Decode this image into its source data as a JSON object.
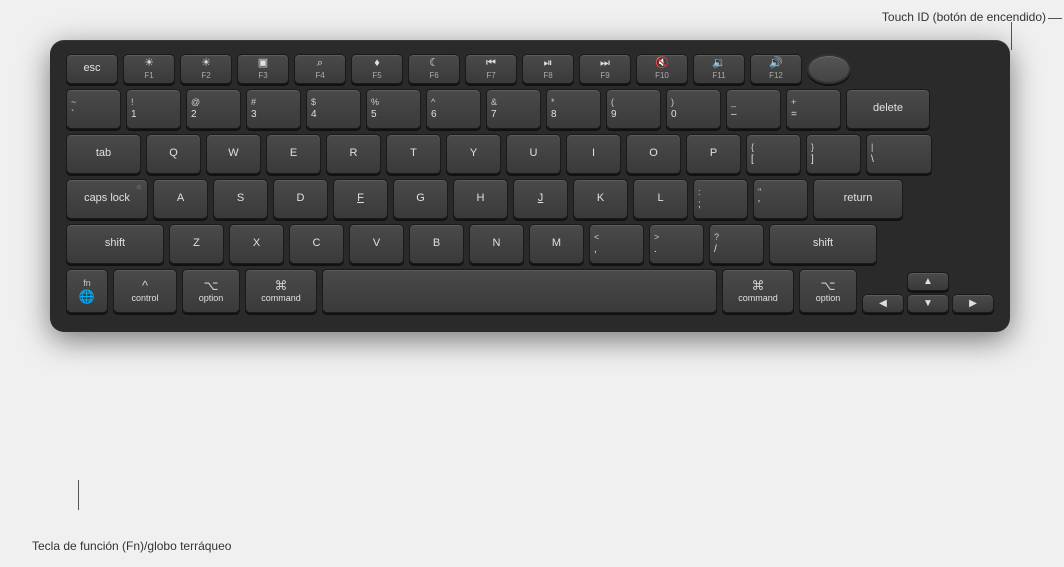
{
  "callout_touch_id": "Touch ID (botón de encendido)",
  "callout_fn": "Tecla de función (Fn)/globo terráqueo",
  "keyboard": {
    "row_fn": [
      {
        "label": "esc",
        "type": "esc"
      },
      {
        "label": "F1",
        "icon": "☀",
        "type": "fn"
      },
      {
        "label": "F2",
        "icon": "☀",
        "type": "fn"
      },
      {
        "label": "F3",
        "icon": "⊞",
        "type": "fn"
      },
      {
        "label": "F4",
        "icon": "⌕",
        "type": "fn"
      },
      {
        "label": "F5",
        "icon": "🎤",
        "type": "fn"
      },
      {
        "label": "F6",
        "icon": "☽",
        "type": "fn"
      },
      {
        "label": "F7",
        "icon": "«",
        "type": "fn"
      },
      {
        "label": "F8",
        "icon": "▶‖",
        "type": "fn"
      },
      {
        "label": "F9",
        "icon": "»",
        "type": "fn"
      },
      {
        "label": "F10",
        "icon": "🔇",
        "type": "fn"
      },
      {
        "label": "F11",
        "icon": "🔉",
        "type": "fn"
      },
      {
        "label": "F12",
        "icon": "🔊",
        "type": "fn"
      },
      {
        "label": "touch-id",
        "type": "touchid"
      }
    ],
    "row_numbers": [
      {
        "top": "~",
        "bottom": "`"
      },
      {
        "top": "!",
        "bottom": "1"
      },
      {
        "top": "@",
        "bottom": "2"
      },
      {
        "top": "#",
        "bottom": "3"
      },
      {
        "top": "$",
        "bottom": "4"
      },
      {
        "top": "%",
        "bottom": "5"
      },
      {
        "top": "^",
        "bottom": "6"
      },
      {
        "top": "&",
        "bottom": "7"
      },
      {
        "top": "*",
        "bottom": "8"
      },
      {
        "top": "(",
        "bottom": "9"
      },
      {
        "top": ")",
        "bottom": "0"
      },
      {
        "top": "_",
        "bottom": "–"
      },
      {
        "top": "+",
        "bottom": "="
      },
      {
        "label": "delete",
        "type": "special"
      }
    ],
    "row_qwerty": [
      "Q",
      "W",
      "E",
      "R",
      "T",
      "Y",
      "U",
      "I",
      "O",
      "P"
    ],
    "row_qwerty_special": [
      {
        "top": "{",
        "bottom": "["
      },
      {
        "top": "}",
        "bottom": "]"
      },
      {
        "top": "|",
        "bottom": "\\"
      }
    ],
    "row_asdf": [
      "A",
      "S",
      "D",
      "F",
      "G",
      "H",
      "J",
      "K",
      "L"
    ],
    "row_asdf_special": [
      {
        "top": ":",
        "bottom": ";"
      },
      {
        "top": "\"",
        "bottom": "'"
      }
    ],
    "row_zxcv": [
      "Z",
      "X",
      "C",
      "V",
      "B",
      "N",
      "M"
    ],
    "row_zxcv_special": [
      {
        "top": "<",
        "bottom": ","
      },
      {
        "top": ">",
        "bottom": "."
      },
      {
        "top": "?",
        "bottom": "/"
      }
    ],
    "bottom_row": {
      "fn": {
        "line1": "fn",
        "line2": "🌐"
      },
      "control": {
        "icon": "^",
        "label": "control"
      },
      "option_l": {
        "icon": "⌥",
        "label": "option"
      },
      "command_l": {
        "icon": "⌘",
        "label": "command"
      },
      "command_r": {
        "icon": "⌘",
        "label": "command"
      },
      "option_r": {
        "icon": "⌥",
        "label": "option"
      },
      "arrows": {
        "up": "▲",
        "left": "◀",
        "down": "▼",
        "right": "▶"
      }
    }
  }
}
